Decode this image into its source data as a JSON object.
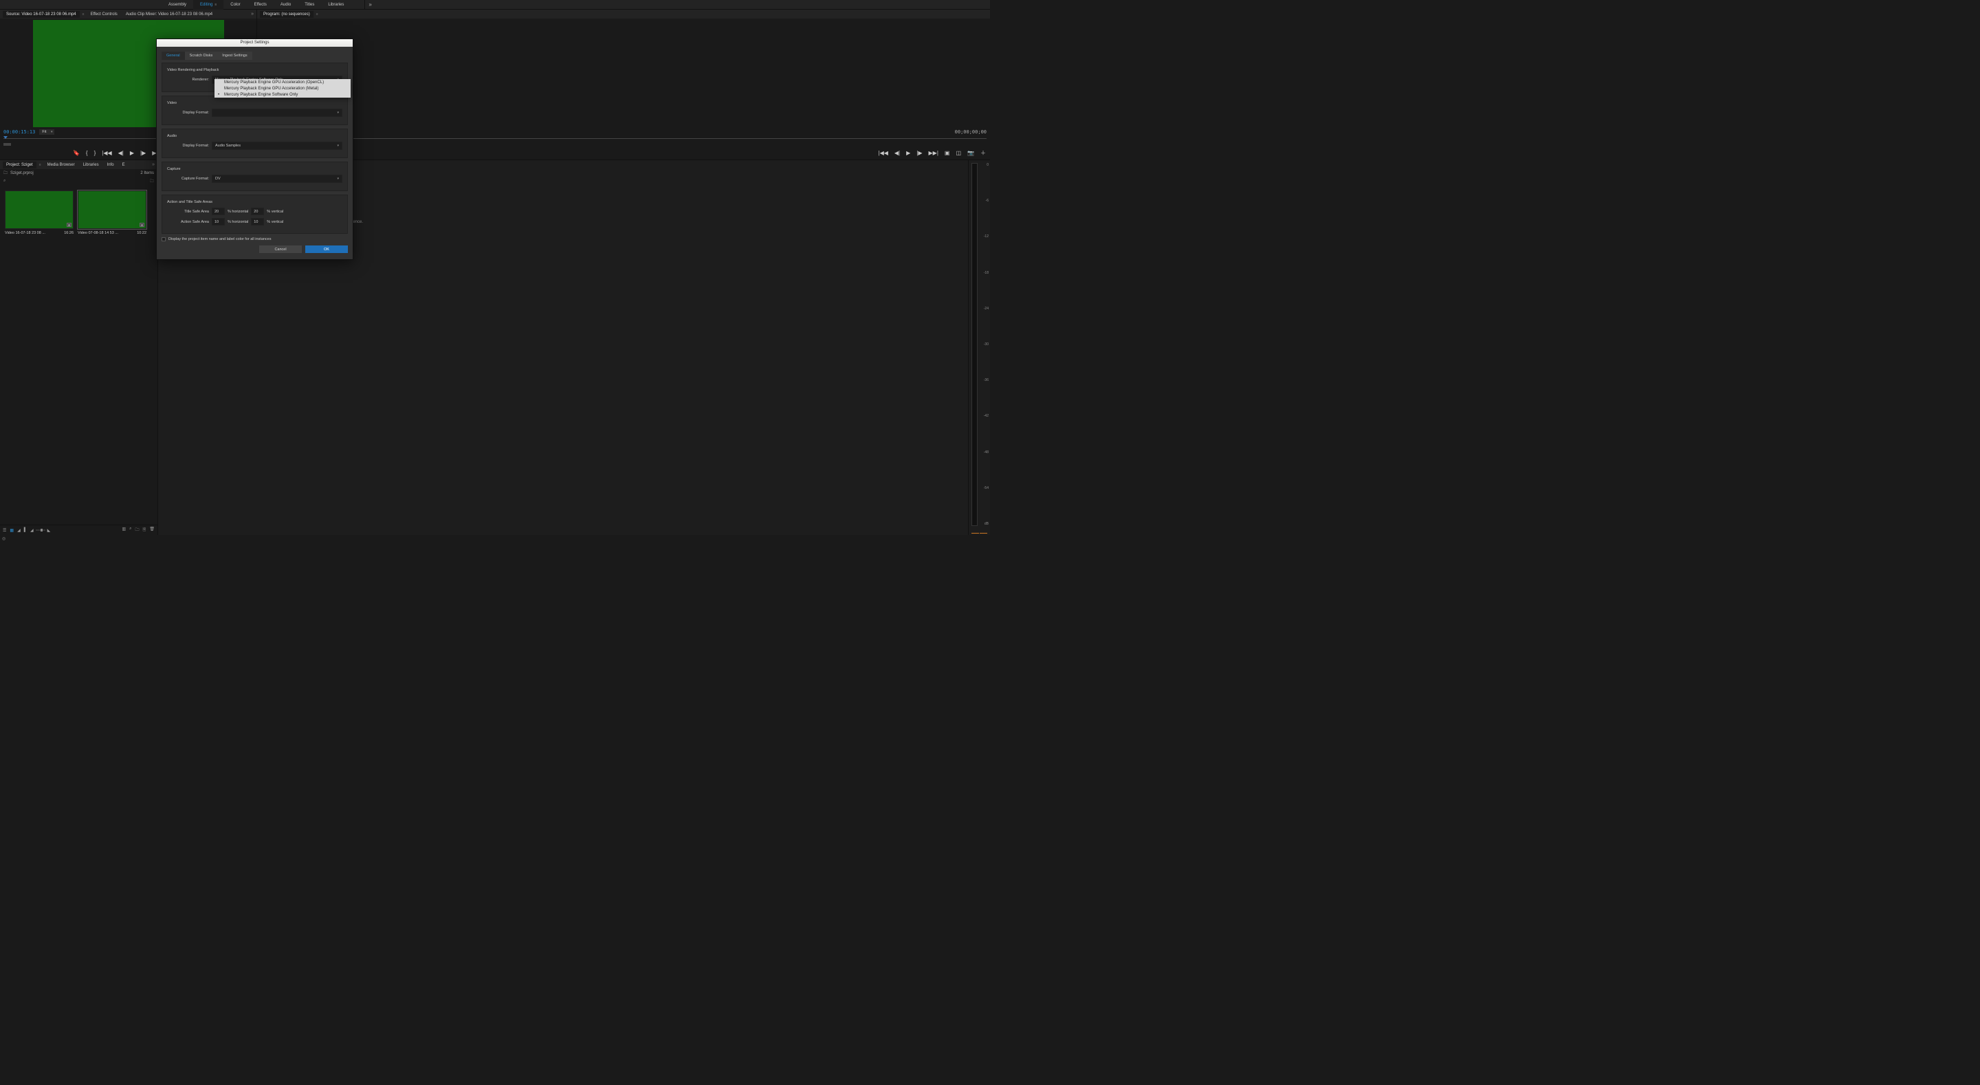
{
  "workspace": {
    "tabs": [
      "Assembly",
      "Editing",
      "Color",
      "Effects",
      "Audio",
      "Titles",
      "Libraries"
    ],
    "active": "Editing",
    "overflow_glyph": "»"
  },
  "source_panel": {
    "tabs": [
      "Source: Video 16-07-18 23 08 06.mp4",
      "Effect Controls",
      "Audio Clip Mixer: Video 16-07-18 23 08 06.mp4"
    ],
    "timecode": "00:00:15:13",
    "fit_label": "Fit",
    "overflow_glyph": "»"
  },
  "program_panel": {
    "tab": "Program: (no sequences)",
    "timecode": "00;00;00;00"
  },
  "project_panel": {
    "tabs": [
      "Project: Sziget",
      "Media Browser",
      "Libraries",
      "Info",
      "E"
    ],
    "overflow_glyph": "»",
    "project_file": "Sziget.prproj",
    "item_count": "2 Items",
    "clips": [
      {
        "name": "Video 16-07-18 23 08 ...",
        "duration": "16:26",
        "selected": false
      },
      {
        "name": "Video 07-08-18 14 53 ...",
        "duration": "10:22",
        "selected": true
      }
    ]
  },
  "timeline_panel": {
    "empty_msg_suffix": "uence."
  },
  "audio_meter": {
    "ticks": [
      "0",
      "-6",
      "-12",
      "-18",
      "-24",
      "-30",
      "-36",
      "-42",
      "-48",
      "-54"
    ],
    "unit_label": "dB"
  },
  "modal": {
    "title": "Project Settings",
    "tabs": [
      "General",
      "Scratch Disks",
      "Ingest Settings"
    ],
    "active_tab": "General",
    "sections": {
      "rendering": {
        "title": "Video Rendering and Playback",
        "renderer_label": "Renderer:",
        "renderer_value": "Mercury Playback Engine Software Only"
      },
      "video": {
        "title": "Video",
        "display_format_label": "Display Format:"
      },
      "audio": {
        "title": "Audio",
        "display_format_label": "Display Format:",
        "display_format_value": "Audio Samples"
      },
      "capture": {
        "title": "Capture",
        "capture_format_label": "Capture Format:",
        "capture_format_value": "DV"
      },
      "safe_areas": {
        "title": "Action and Title Safe Areas",
        "title_safe_label": "Title Safe Area",
        "action_safe_label": "Action Safe Area",
        "title_h": "20",
        "title_v": "20",
        "action_h": "10",
        "action_v": "10",
        "h_unit": "% horizontal",
        "v_unit": "% vertical"
      },
      "instance_check": "Display the project item name and label color for all instances"
    },
    "buttons": {
      "cancel": "Cancel",
      "ok": "OK"
    },
    "dropdown_options": [
      "Mercury Playback Engine GPU Acceleration (OpenCL)",
      "Mercury Playback Engine GPU Acceleration (Metal)",
      "Mercury Playback Engine Software Only"
    ],
    "dropdown_selected_index": 2
  }
}
